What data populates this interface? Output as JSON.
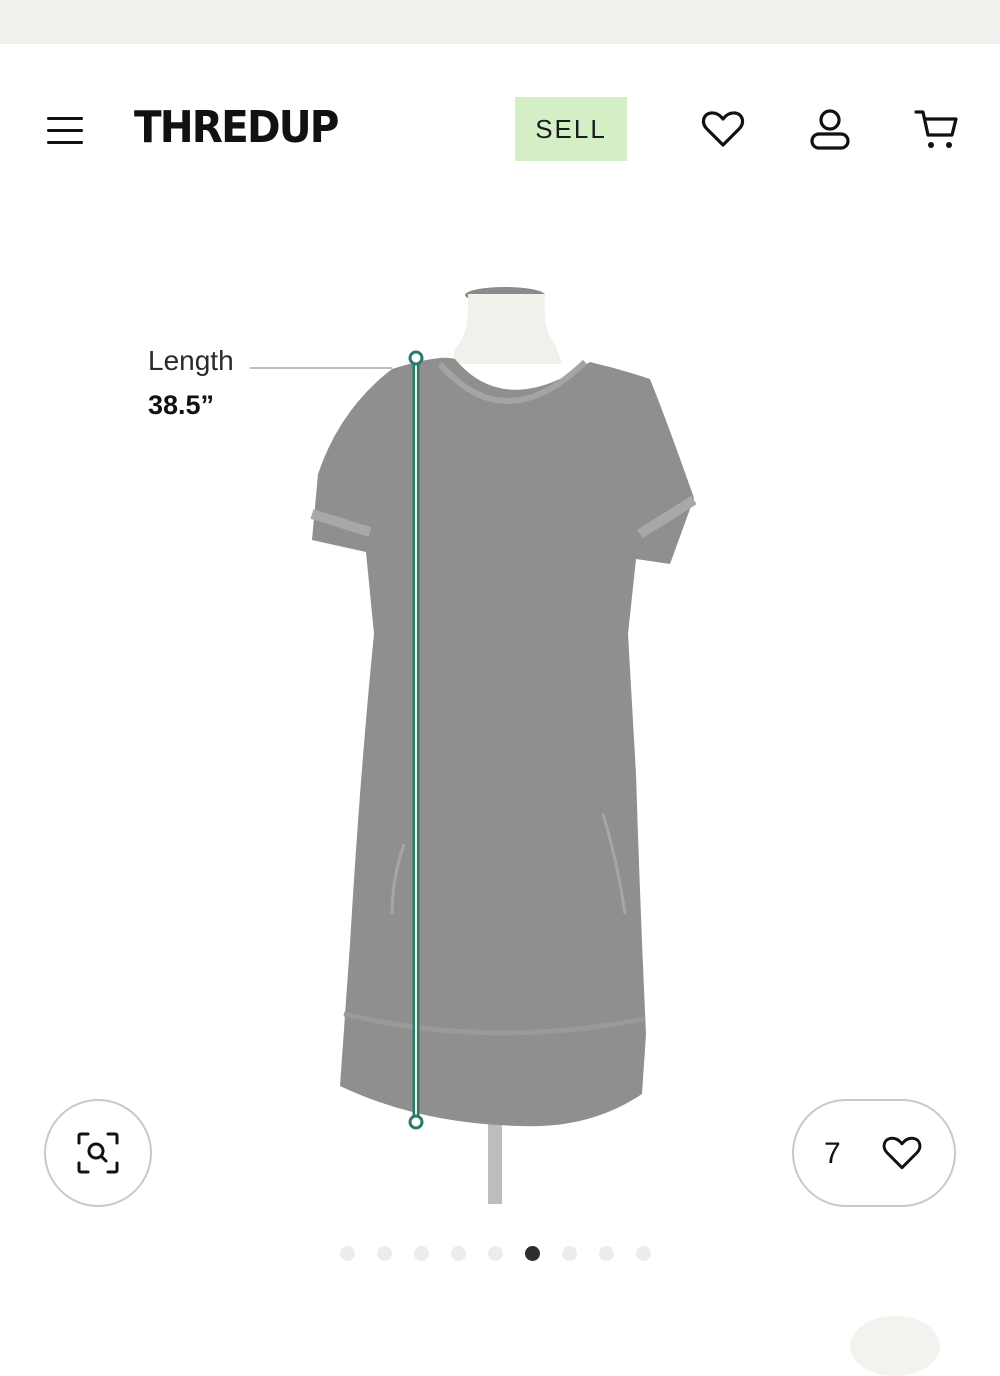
{
  "header": {
    "logo": "THREDUP",
    "sell_label": "SELL",
    "icons": [
      "menu-icon",
      "heart-icon",
      "user-icon",
      "cart-icon"
    ]
  },
  "product_image": {
    "measurement": {
      "label": "Length",
      "value": "38.5”"
    }
  },
  "actions": {
    "favorite_count": "7"
  },
  "carousel": {
    "total": 9,
    "active_index": 5
  },
  "colors": {
    "sell_bg": "#d4efc6",
    "measure_line": "#2c7a6a",
    "dress": "#8d8d8d"
  }
}
